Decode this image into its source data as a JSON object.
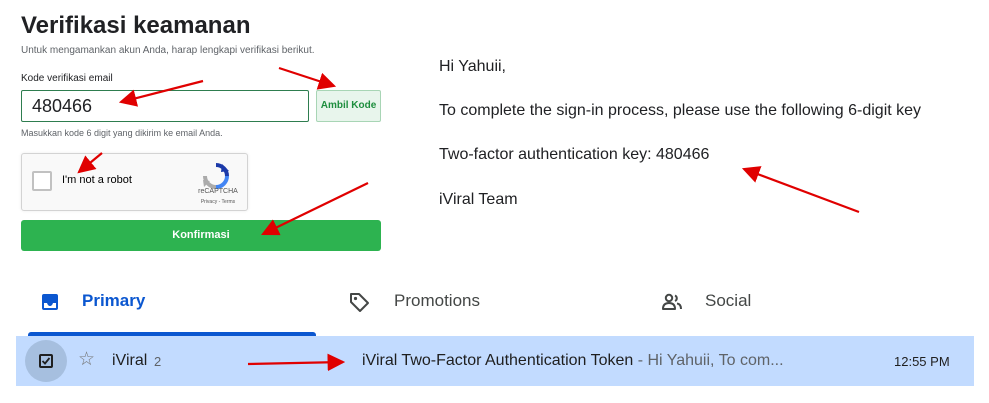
{
  "verification": {
    "title": "Verifikasi keamanan",
    "subtitle": "Untuk mengamankan akun Anda, harap lengkapi verifikasi berikut.",
    "code_label": "Kode verifikasi email",
    "code_value": "480466",
    "get_code_button": "Ambil Kode",
    "helper_text": "Masukkan kode 6 digit yang dikirim ke email Anda.",
    "confirm_button": "Konfirmasi"
  },
  "recaptcha": {
    "checkbox_label": "I'm not a robot",
    "brand": "reCAPTCHA",
    "links": "Privacy - Terms"
  },
  "email_body": {
    "greeting": "Hi Yahuii,",
    "line1": "To complete the sign-in process, please use the following 6-digit key",
    "key_line": "Two-factor authentication key: 480466",
    "signature": "iViral Team"
  },
  "inbox": {
    "tabs": [
      {
        "label": "Primary",
        "icon": "inbox-icon",
        "selected": true
      },
      {
        "label": "Promotions",
        "icon": "tag-icon",
        "selected": false
      },
      {
        "label": "Social",
        "icon": "people-icon",
        "selected": false
      }
    ],
    "row": {
      "sender": "iViral",
      "count": "2",
      "subject": "iViral Two-Factor Authentication Token",
      "snippet": " - Hi Yahuii, To com...",
      "time": "12:55 PM",
      "selected": true,
      "starred": false
    }
  },
  "colors": {
    "accent_green": "#2db350",
    "primary_blue": "#0b57d0",
    "selected_row": "#c2dbff",
    "annotation_red": "#e00000"
  }
}
